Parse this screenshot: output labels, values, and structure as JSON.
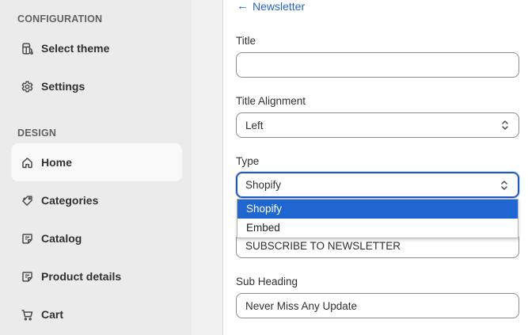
{
  "sidebar": {
    "config_heading": "CONFIGURATION",
    "design_heading": "DESIGN",
    "config_items": [
      {
        "label": "Select theme",
        "icon": "theme-icon"
      },
      {
        "label": "Settings",
        "icon": "gear-icon"
      }
    ],
    "design_items": [
      {
        "label": "Home",
        "icon": "home-icon",
        "active": true
      },
      {
        "label": "Categories",
        "icon": "tag-icon"
      },
      {
        "label": "Catalog",
        "icon": "catalog-icon"
      },
      {
        "label": "Product details",
        "icon": "product-details-icon"
      },
      {
        "label": "Cart",
        "icon": "cart-icon"
      }
    ]
  },
  "main": {
    "back_label": "Newsletter",
    "title": {
      "label": "Title",
      "value": "",
      "placeholder": ""
    },
    "title_alignment": {
      "label": "Title Alignment",
      "value": "Left"
    },
    "type": {
      "label": "Type",
      "value": "Shopify",
      "options": [
        "Shopify",
        "Embed"
      ]
    },
    "heading": {
      "value": "SUBSCRIBE TO NEWSLETTER"
    },
    "sub_heading": {
      "label": "Sub Heading",
      "value": "Never Miss Any Update"
    }
  },
  "colors": {
    "accent": "#2463d6",
    "selected_option": "#1f66d1",
    "sidebar_bg": "#ebebeb"
  }
}
